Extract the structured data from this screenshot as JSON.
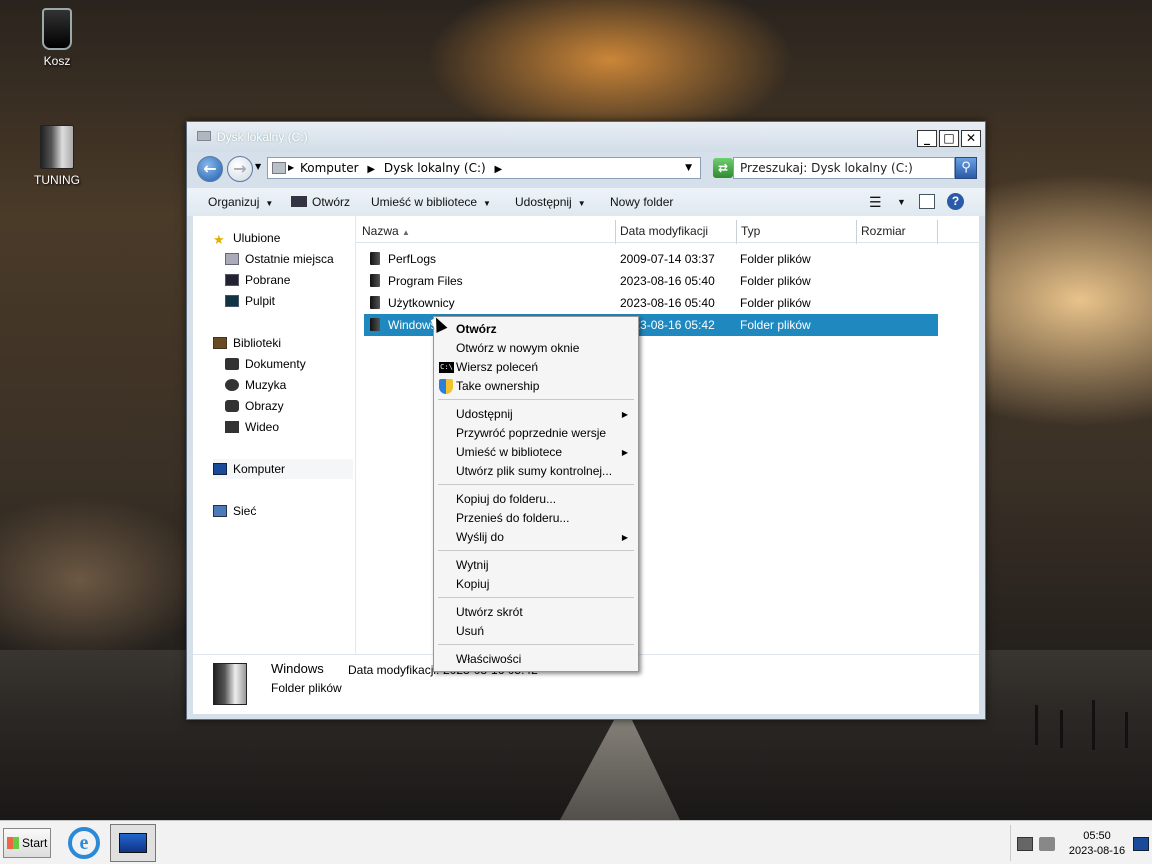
{
  "desktop": {
    "icons": [
      {
        "label": "Kosz",
        "icon": "recycle-bin-icon"
      },
      {
        "label": "TUNING",
        "icon": "folder-icon"
      }
    ]
  },
  "window": {
    "title": "Dysk lokalny (C:)",
    "controls": {
      "minimize": "_",
      "maximize": "□",
      "close": "✕"
    },
    "address": {
      "breadcrumb": [
        "Komputer",
        "Dysk lokalny (C:)"
      ]
    },
    "search": {
      "placeholder": "Przeszukaj: Dysk lokalny (C:)"
    },
    "commands": {
      "organize": "Organizuj",
      "open": "Otwórz",
      "include_library": "Umieść w bibliotece",
      "share": "Udostępnij",
      "new_folder": "Nowy folder"
    },
    "nav": {
      "favorites": "Ulubione",
      "favorites_items": [
        "Ostatnie miejsca",
        "Pobrane",
        "Pulpit"
      ],
      "libraries": "Biblioteki",
      "libraries_items": [
        "Dokumenty",
        "Muzyka",
        "Obrazy",
        "Wideo"
      ],
      "computer": "Komputer",
      "network": "Sieć"
    },
    "columns": [
      "Nazwa",
      "Data modyfikacji",
      "Typ",
      "Rozmiar"
    ],
    "files": [
      {
        "name": "PerfLogs",
        "modified": "2009-07-14 03:37",
        "type": "Folder plików",
        "size": ""
      },
      {
        "name": "Program Files",
        "modified": "2023-08-16 05:40",
        "type": "Folder plików",
        "size": ""
      },
      {
        "name": "Użytkownicy",
        "modified": "2023-08-16 05:40",
        "type": "Folder plików",
        "size": ""
      },
      {
        "name": "Windows",
        "modified": "2023-08-16 05:42",
        "type": "Folder plików",
        "size": "",
        "selected": true
      }
    ],
    "details": {
      "name": "Windows",
      "modified_label": "Data modyfikacji:",
      "modified_value": "2023-08-16 05:42",
      "type": "Folder plików"
    }
  },
  "context_menu": {
    "groups": [
      [
        "Otwórz",
        "Otwórz w nowym oknie",
        "Wiersz poleceń",
        "Take ownership"
      ],
      [
        "Udostępnij",
        "Przywróć poprzednie wersje",
        "Umieść w bibliotece",
        "Utwórz plik sumy kontrolnej..."
      ],
      [
        "Kopiuj do folderu...",
        "Przenieś do folderu...",
        "Wyślij do"
      ],
      [
        "Wytnij",
        "Kopiuj"
      ],
      [
        "Utwórz skrót",
        "Usuń"
      ],
      [
        "Właściwości"
      ]
    ],
    "cmd_icon_text": "C:\\"
  },
  "taskbar": {
    "start": "Start",
    "time": "05:50",
    "date": "2023-08-16"
  },
  "colors": {
    "selection": "#1e88bf",
    "accent": "#2a5aa8"
  }
}
